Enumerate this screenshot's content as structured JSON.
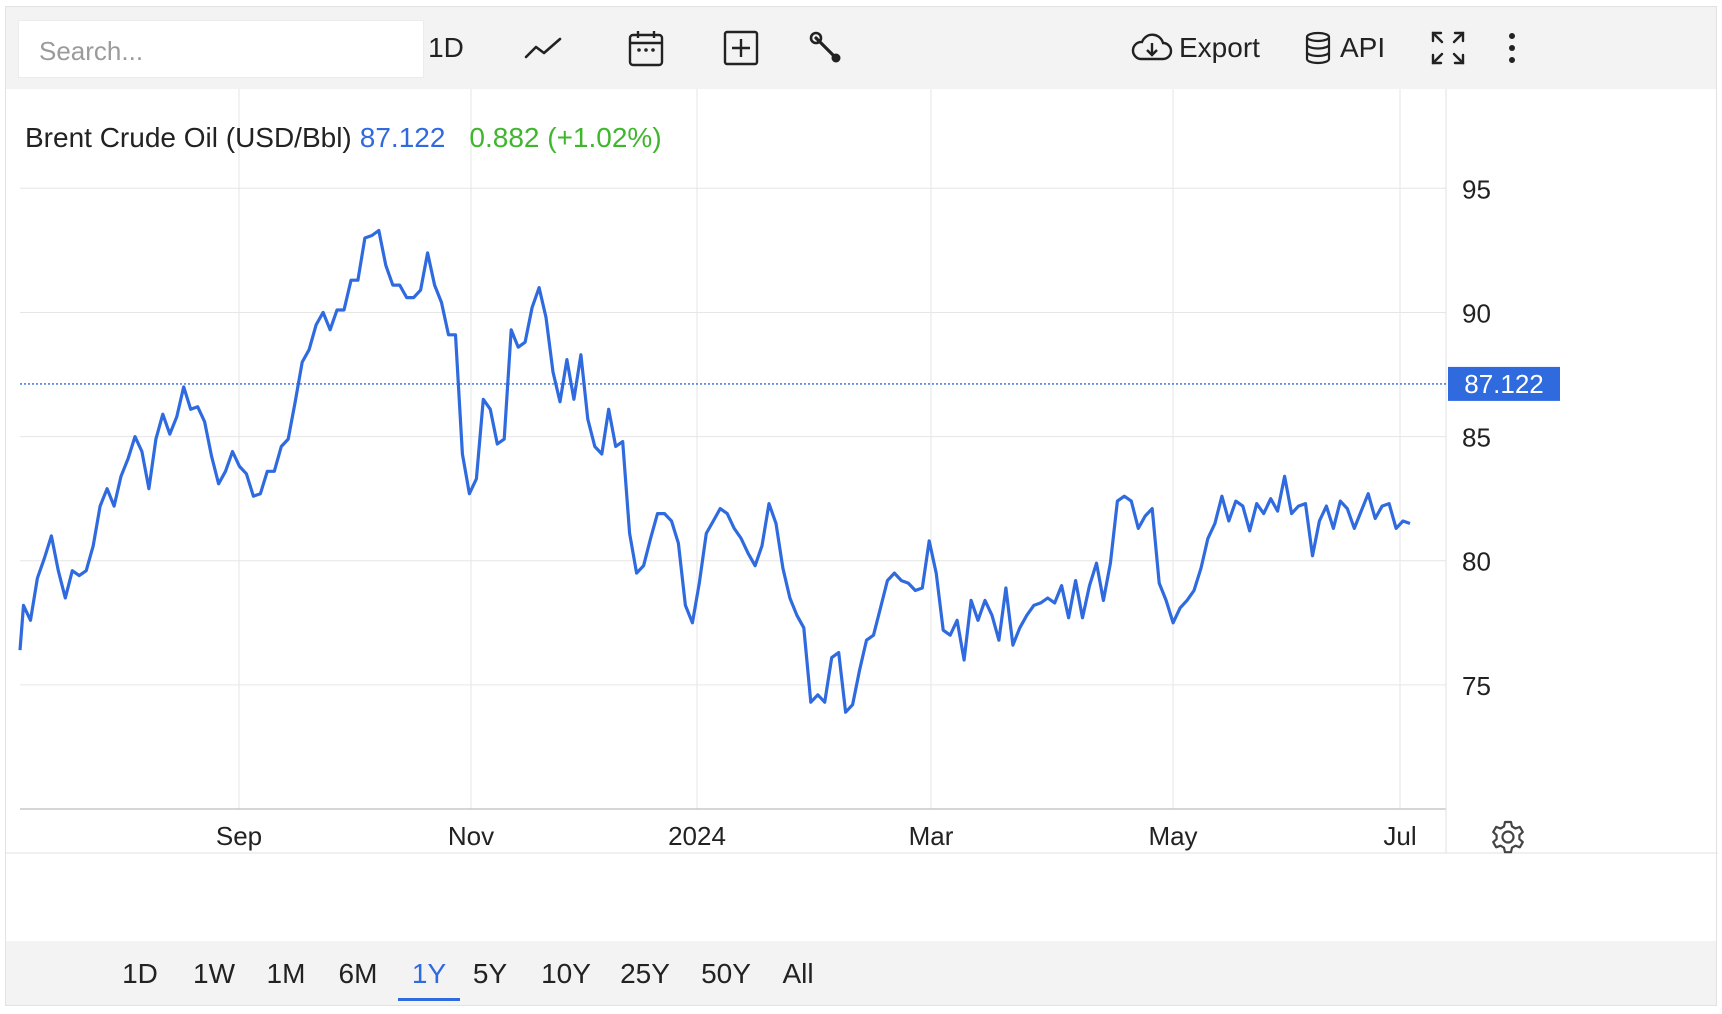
{
  "toolbar": {
    "search_placeholder": "Search...",
    "interval_label": "1D",
    "export_label": "Export",
    "api_label": "API",
    "icons": [
      "line-chart-icon",
      "calendar-icon",
      "add-compare-icon",
      "wrench-icon",
      "cloud-download-icon",
      "database-icon",
      "fullscreen-icon",
      "more-vertical-icon"
    ]
  },
  "legend": {
    "name": "Brent Crude Oil (USD/Bbl)",
    "price": "87.122",
    "change": "0.882 (+1.02%)"
  },
  "colors": {
    "series": "#2f6bdf",
    "change_up": "#3fb72c",
    "grid": "#e6e6e6"
  },
  "ranges": {
    "items": [
      "1D",
      "1W",
      "1M",
      "6M",
      "1Y",
      "5Y",
      "10Y",
      "25Y",
      "50Y",
      "All"
    ],
    "active": "1Y"
  },
  "chart_data": {
    "type": "line",
    "series": [
      {
        "name": "Brent Crude Oil (USD/Bbl)",
        "points": [
          [
            "2023-07-07",
            76.4
          ],
          [
            "2023-07-08",
            78.2
          ],
          [
            "2023-07-10",
            77.6
          ],
          [
            "2023-07-12",
            79.3
          ],
          [
            "2023-07-14",
            80.1
          ],
          [
            "2023-07-16",
            81.0
          ],
          [
            "2023-07-18",
            79.6
          ],
          [
            "2023-07-20",
            78.5
          ],
          [
            "2023-07-22",
            79.6
          ],
          [
            "2023-07-24",
            79.4
          ],
          [
            "2023-07-26",
            79.6
          ],
          [
            "2023-07-28",
            80.6
          ],
          [
            "2023-07-30",
            82.2
          ],
          [
            "2023-08-01",
            82.9
          ],
          [
            "2023-08-03",
            82.2
          ],
          [
            "2023-08-05",
            83.4
          ],
          [
            "2023-08-07",
            84.1
          ],
          [
            "2023-08-09",
            85.0
          ],
          [
            "2023-08-11",
            84.4
          ],
          [
            "2023-08-13",
            82.9
          ],
          [
            "2023-08-15",
            84.9
          ],
          [
            "2023-08-17",
            85.9
          ],
          [
            "2023-08-19",
            85.1
          ],
          [
            "2023-08-21",
            85.8
          ],
          [
            "2023-08-23",
            87.0
          ],
          [
            "2023-08-25",
            86.1
          ],
          [
            "2023-08-27",
            86.2
          ],
          [
            "2023-08-29",
            85.6
          ],
          [
            "2023-08-31",
            84.2
          ],
          [
            "2023-09-02",
            83.1
          ],
          [
            "2023-09-04",
            83.6
          ],
          [
            "2023-09-06",
            84.4
          ],
          [
            "2023-09-08",
            83.8
          ],
          [
            "2023-09-10",
            83.5
          ],
          [
            "2023-09-12",
            82.6
          ],
          [
            "2023-09-14",
            82.7
          ],
          [
            "2023-09-16",
            83.6
          ],
          [
            "2023-09-18",
            83.6
          ],
          [
            "2023-09-20",
            84.6
          ],
          [
            "2023-09-22",
            84.9
          ],
          [
            "2023-09-24",
            86.4
          ],
          [
            "2023-09-26",
            88.0
          ],
          [
            "2023-09-28",
            88.5
          ],
          [
            "2023-09-30",
            89.5
          ],
          [
            "2023-10-02",
            90.0
          ],
          [
            "2023-10-04",
            89.3
          ],
          [
            "2023-10-06",
            90.1
          ],
          [
            "2023-10-08",
            90.1
          ],
          [
            "2023-10-10",
            91.3
          ],
          [
            "2023-10-12",
            91.3
          ],
          [
            "2023-10-14",
            93.0
          ],
          [
            "2023-10-16",
            93.1
          ],
          [
            "2023-10-18",
            93.3
          ],
          [
            "2023-10-20",
            91.9
          ],
          [
            "2023-10-22",
            91.1
          ],
          [
            "2023-10-24",
            91.1
          ],
          [
            "2023-10-26",
            90.6
          ],
          [
            "2023-10-28",
            90.6
          ],
          [
            "2023-10-30",
            90.9
          ],
          [
            "2023-11-01",
            92.4
          ],
          [
            "2023-11-03",
            91.1
          ],
          [
            "2023-11-05",
            90.4
          ],
          [
            "2023-11-07",
            89.1
          ],
          [
            "2023-11-09",
            89.1
          ],
          [
            "2023-11-11",
            84.3
          ],
          [
            "2023-11-13",
            82.7
          ],
          [
            "2023-11-15",
            83.3
          ],
          [
            "2023-11-17",
            86.5
          ],
          [
            "2023-11-19",
            86.1
          ],
          [
            "2023-11-21",
            84.7
          ],
          [
            "2023-11-23",
            84.9
          ],
          [
            "2023-11-25",
            89.3
          ],
          [
            "2023-11-27",
            88.6
          ],
          [
            "2023-11-29",
            88.8
          ],
          [
            "2023-12-01",
            90.2
          ],
          [
            "2023-12-03",
            91.0
          ],
          [
            "2023-12-05",
            89.8
          ],
          [
            "2023-12-07",
            87.6
          ],
          [
            "2023-12-09",
            86.4
          ],
          [
            "2023-12-11",
            88.1
          ],
          [
            "2023-12-13",
            86.5
          ],
          [
            "2023-12-15",
            88.3
          ],
          [
            "2023-12-17",
            85.7
          ],
          [
            "2023-12-19",
            84.6
          ],
          [
            "2023-12-21",
            84.3
          ],
          [
            "2023-12-23",
            86.1
          ],
          [
            "2023-12-25",
            84.6
          ],
          [
            "2023-12-27",
            84.8
          ],
          [
            "2023-12-29",
            81.1
          ],
          [
            "2023-12-31",
            79.5
          ],
          [
            "2024-01-02",
            79.8
          ],
          [
            "2024-01-04",
            80.9
          ],
          [
            "2024-01-06",
            81.9
          ],
          [
            "2024-01-08",
            81.9
          ],
          [
            "2024-01-10",
            81.6
          ],
          [
            "2024-01-12",
            80.7
          ],
          [
            "2024-01-14",
            78.2
          ],
          [
            "2024-01-16",
            77.5
          ],
          [
            "2024-01-18",
            79.1
          ],
          [
            "2024-01-20",
            81.1
          ],
          [
            "2024-01-22",
            81.6
          ],
          [
            "2024-01-24",
            82.1
          ],
          [
            "2024-01-26",
            81.9
          ],
          [
            "2024-01-28",
            81.3
          ],
          [
            "2024-01-30",
            80.9
          ],
          [
            "2024-02-01",
            80.3
          ],
          [
            "2024-02-03",
            79.8
          ],
          [
            "2024-02-05",
            80.6
          ],
          [
            "2024-02-07",
            82.3
          ],
          [
            "2024-02-09",
            81.5
          ],
          [
            "2024-02-11",
            79.7
          ],
          [
            "2024-02-13",
            78.5
          ],
          [
            "2024-02-15",
            77.8
          ],
          [
            "2024-02-17",
            77.3
          ],
          [
            "2024-02-19",
            74.3
          ],
          [
            "2024-02-21",
            74.6
          ],
          [
            "2024-02-23",
            74.3
          ],
          [
            "2024-02-25",
            76.1
          ],
          [
            "2024-02-27",
            76.3
          ],
          [
            "2024-02-29",
            73.9
          ],
          [
            "2024-03-02",
            74.2
          ],
          [
            "2024-03-04",
            75.6
          ],
          [
            "2024-03-06",
            76.8
          ],
          [
            "2024-03-08",
            77.0
          ],
          [
            "2024-03-10",
            78.1
          ],
          [
            "2024-03-12",
            79.2
          ],
          [
            "2024-03-14",
            79.5
          ],
          [
            "2024-03-16",
            79.2
          ],
          [
            "2024-03-18",
            79.1
          ],
          [
            "2024-03-20",
            78.8
          ],
          [
            "2024-03-22",
            78.9
          ],
          [
            "2024-03-24",
            80.8
          ],
          [
            "2024-03-26",
            79.5
          ],
          [
            "2024-03-28",
            77.2
          ],
          [
            "2024-03-30",
            77.0
          ],
          [
            "2024-04-01",
            77.6
          ],
          [
            "2024-04-03",
            76.0
          ],
          [
            "2024-04-05",
            78.4
          ],
          [
            "2024-04-07",
            77.6
          ],
          [
            "2024-04-09",
            78.4
          ],
          [
            "2024-04-11",
            77.8
          ],
          [
            "2024-04-13",
            76.8
          ],
          [
            "2024-04-15",
            78.9
          ],
          [
            "2024-04-17",
            76.6
          ],
          [
            "2024-04-19",
            77.3
          ],
          [
            "2024-04-21",
            77.8
          ],
          [
            "2024-04-23",
            78.2
          ],
          [
            "2024-04-25",
            78.3
          ],
          [
            "2024-04-27",
            78.5
          ],
          [
            "2024-04-29",
            78.3
          ],
          [
            "2024-05-01",
            79.0
          ],
          [
            "2024-05-03",
            77.7
          ],
          [
            "2024-05-05",
            79.2
          ],
          [
            "2024-05-07",
            77.7
          ],
          [
            "2024-05-09",
            79.0
          ],
          [
            "2024-05-11",
            79.9
          ],
          [
            "2024-05-13",
            78.4
          ],
          [
            "2024-05-15",
            79.9
          ],
          [
            "2024-05-17",
            82.4
          ],
          [
            "2024-05-19",
            82.6
          ],
          [
            "2024-05-21",
            82.4
          ],
          [
            "2024-05-23",
            81.3
          ],
          [
            "2024-05-25",
            81.8
          ],
          [
            "2024-05-27",
            82.1
          ],
          [
            "2024-05-29",
            79.1
          ],
          [
            "2024-05-31",
            78.4
          ],
          [
            "2024-06-02",
            77.5
          ],
          [
            "2024-06-04",
            78.1
          ],
          [
            "2024-06-06",
            78.4
          ],
          [
            "2024-06-08",
            78.8
          ],
          [
            "2024-06-10",
            79.7
          ],
          [
            "2024-06-12",
            80.9
          ],
          [
            "2024-06-14",
            81.5
          ],
          [
            "2024-06-16",
            82.6
          ],
          [
            "2024-06-18",
            81.6
          ],
          [
            "2024-06-20",
            82.4
          ],
          [
            "2024-06-22",
            82.2
          ],
          [
            "2024-06-24",
            81.2
          ],
          [
            "2024-06-26",
            82.3
          ],
          [
            "2024-06-28",
            81.9
          ],
          [
            "2024-06-30",
            82.5
          ],
          [
            "2024-07-02",
            82.0
          ],
          [
            "2024-07-04",
            83.4
          ],
          [
            "2024-07-06",
            81.9
          ],
          [
            "2024-07-08",
            82.2
          ],
          [
            "2024-07-10",
            82.3
          ],
          [
            "2024-07-12",
            80.2
          ],
          [
            "2024-07-14",
            81.6
          ],
          [
            "2024-07-16",
            82.2
          ],
          [
            "2024-07-18",
            81.3
          ],
          [
            "2024-07-20",
            82.4
          ],
          [
            "2024-07-22",
            82.1
          ],
          [
            "2024-07-24",
            81.3
          ],
          [
            "2024-07-26",
            82.0
          ],
          [
            "2024-07-28",
            82.7
          ],
          [
            "2024-07-30",
            81.7
          ],
          [
            "2024-08-01",
            82.2
          ],
          [
            "2024-08-03",
            82.3
          ],
          [
            "2024-08-05",
            81.3
          ],
          [
            "2024-08-07",
            81.6
          ],
          [
            "2024-08-09",
            81.5
          ]
        ]
      }
    ],
    "x_ticks": [
      "Sep",
      "Nov",
      "2024",
      "Mar",
      "May",
      "Jul"
    ],
    "y_ticks": [
      75,
      80,
      85,
      90,
      95
    ],
    "ylim": [
      70,
      99
    ],
    "last_value": "87.122",
    "grid": true
  }
}
